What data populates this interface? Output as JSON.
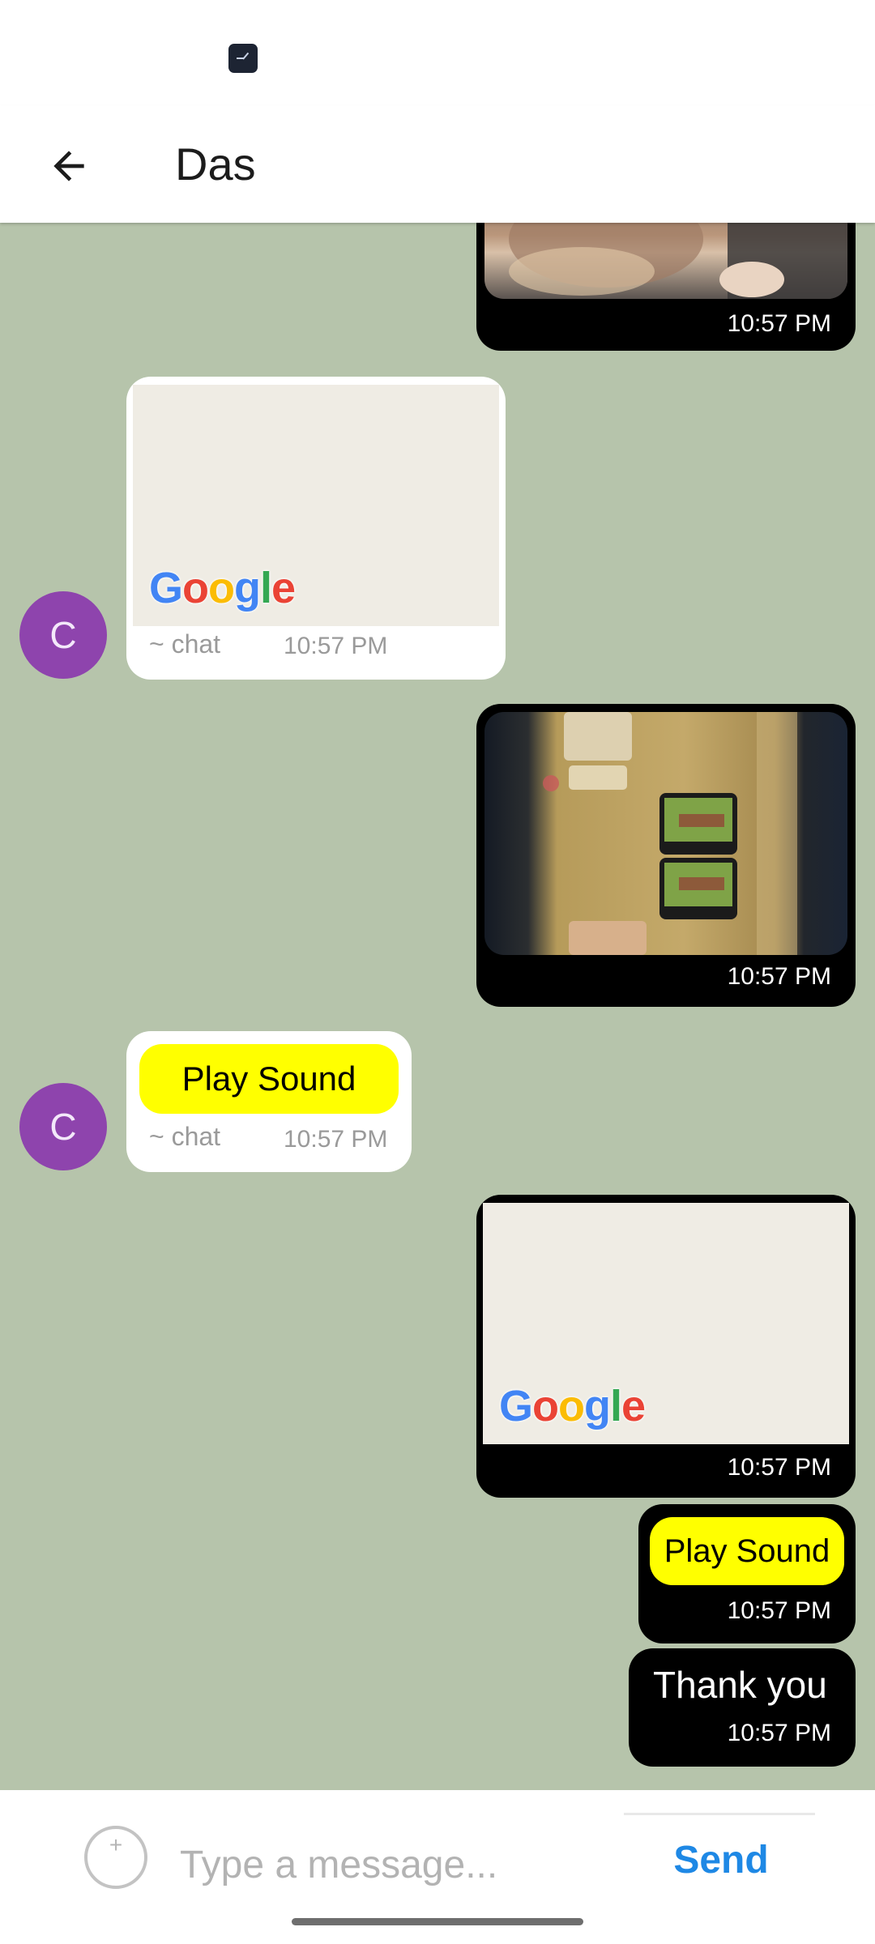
{
  "header": {
    "title": "Das"
  },
  "contact": {
    "avatar_initial": "C"
  },
  "messages": {
    "m1": {
      "time": "10:57 PM"
    },
    "m2": {
      "sender": "~ chat",
      "time": "10:57 PM",
      "map_logo": "Google"
    },
    "m3": {
      "time": "10:57 PM"
    },
    "m4": {
      "sender": "~ chat",
      "time": "10:57 PM",
      "button_label": "Play Sound"
    },
    "m5": {
      "time": "10:57 PM",
      "map_logo": "Google"
    },
    "m6": {
      "time": "10:57 PM",
      "button_label": "Play Sound"
    },
    "m7": {
      "time": "10:57 PM",
      "text": "Thank you"
    }
  },
  "composer": {
    "attach_glyph": "+",
    "placeholder": "Type a message...",
    "send_label": "Send"
  },
  "colors": {
    "background": "#b6c4ab",
    "outgoing_bubble": "#000000",
    "incoming_bubble": "#ffffff",
    "avatar": "#8e44ad",
    "play_button": "#ffff00",
    "send": "#1e88e5"
  },
  "icons": {
    "back": "arrow-left-icon",
    "attach": "plus-circle-icon",
    "status": "clock-app-icon"
  }
}
